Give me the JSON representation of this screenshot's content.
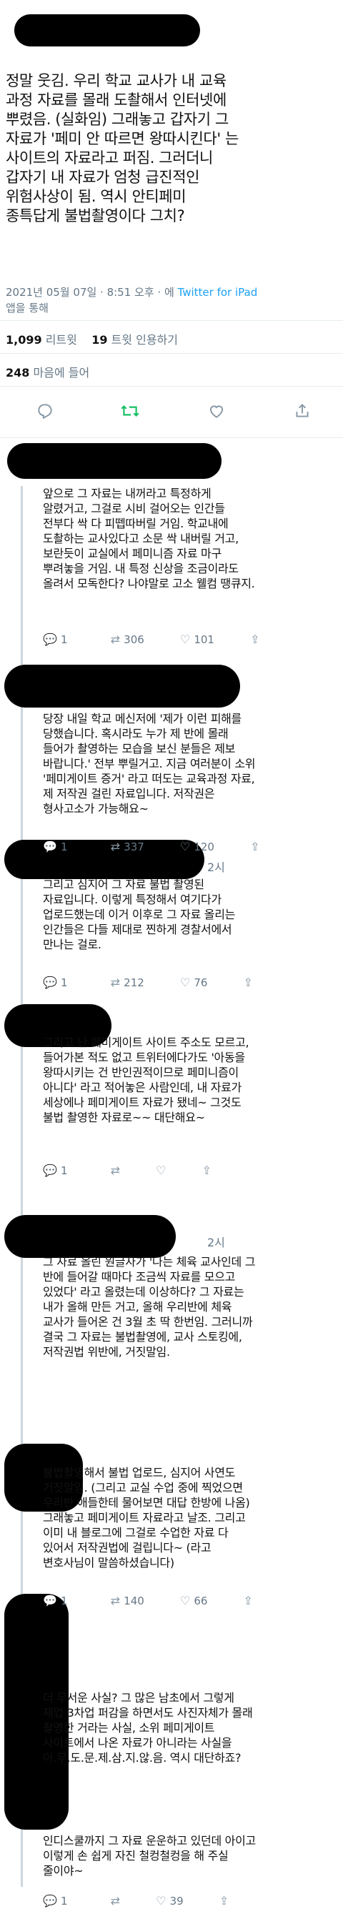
{
  "tweet": {
    "text_lines": [
      "정말 웃김. 우리 학교 교사가 내 교육",
      "과정 자료를 몰래 도촬해서 인터넷에",
      "뿌렸음. (실화임) 그래놓고 갑자기 그",
      "자료가 '페미 안 따르면 왕따시킨다' 는",
      "사이트의 자료라고 퍼짐. 그러더니",
      "갑자기 내 자료가 엄청 급진적인",
      "위험사상이 됨. 역시 안티페미",
      "종특답게 불법촬영이다 그치?"
    ],
    "date": "2021년 05월 07일 · 8:51 오후 · 에",
    "source": "Twitter for iPad",
    "via": "앱을 통해",
    "retweets_count": "1,099",
    "retweets_label": "리트윗",
    "quotes_count": "19",
    "quotes_label": "트윗 인용하기",
    "likes_count": "248",
    "likes_label": "마음에 들어"
  },
  "replies": [
    {
      "name": "",
      "lines": [
        "앞으로 그 자료는 내꺼라고 특정하게",
        "알렸거고, 그걸로 시비 걸어오는 인간들",
        "전부다 싹 다 피뗍따버릴 거임. 학교내에",
        "도촬하는 교사있다고 소문 싹 내버릴 거고,",
        "보란듯이 교실에서 페미니즘 자료 마구",
        "뿌려놓을 거임. 내 특정 신상을 조금이라도",
        "올려서 모독한다? 나야말로 고소 웰컴 땡큐지."
      ],
      "replies": "1",
      "retweets": "306",
      "likes": "101"
    },
    {
      "name": "",
      "lines": [
        "당장 내일 학교 메신저에 '제가 이런 피해를",
        "당했습니다. 혹시라도 누가 제 반에 몰래",
        "들어가 촬영하는 모습을 보신 분들은 제보",
        "바랍니다.' 전부 뿌릴거고. 지금 여러분이 소위",
        "'페미게이트 증거' 라고 떠도는 교육과정 자료,",
        "제 저작권 걸린 자료입니다. 저작권은",
        "형사고소가 가능해요~"
      ],
      "replies": "1",
      "retweets": "337",
      "likes": "120"
    },
    {
      "name": "2시",
      "lines": [
        "그리고 심지어 그 자료 불법 촬영된",
        "자료입니다. 이렇게 특정해서 여기다가",
        "업로드했는데 이거 이후로 그 자료 올리는",
        "인간들은 다들 제대로 찐하게 경찰서에서",
        "만나는 걸로."
      ],
      "replies": "1",
      "retweets": "212",
      "likes": "76"
    },
    {
      "name": "",
      "lines": [
        "그리고 난 페미게이트 사이트 주소도 모르고,",
        "들어가본 적도 없고 트위터에다가도 '아동을",
        "왕따시키는 건 반인권적이므로 페미니즘이",
        "아니다' 라고 적어놓은 사람인데, 내 자료가",
        "세상에나 페미게이트 자료가 됐네~ 그것도",
        "불법 촬영한 자료로~~ 대단해요~"
      ],
      "replies": "1",
      "retweets": "",
      "likes": ""
    },
    {
      "name": "2시",
      "lines": [
        "그 자료 올린 원글자가 '나는 체육 교사인데 그",
        "반에 들어갈 때마다 조금씩 자료를 모으고",
        "있었다' 라고 올렸는데 이상하다? 그 자료는",
        "내가 올해 만든 거고, 올해 우리반에 체육",
        "교사가 들어온 건 3월 초 딱 한번임. 그러니까",
        "결국 그 자료는 불법촬영에, 교사 스토킹에,",
        "저작권법 위반에, 거짓말임."
      ],
      "replies": "",
      "retweets": "",
      "likes": ""
    },
    {
      "name": "",
      "lines": [
        "불법촬영해서 불법 업로드, 심지어 사연도",
        "거짓말임. (그리고 교실 수업 중에 찍었으면",
        "우리반 애들한테 물어보면 대답 한방에 나옴)",
        "그래놓고 페미게이트 자료라고 날조. 그리고",
        "이미 내 블로그에 그걸로 수업한 자료 다",
        "있어서 저작권법에 걸립니다~ (라고",
        "변호사님이 말씀하셨습니다)"
      ],
      "replies": "1",
      "retweets": "140",
      "likes": "66"
    },
    {
      "name": "",
      "lines": [
        "더 무서운 사실? 그 많은 남초에서 그렇게",
        "재업 3차업 퍼감을 하면서도 사진자체가 몰래",
        "촬영한 거라는 사실, 소위 페미게이트",
        "사이트에서 나온 자료가 아니라는 사실을",
        "아.무.도.문.제.삼.지.않.음. 역시 대단하죠?"
      ],
      "replies": "",
      "retweets": "",
      "likes": ""
    },
    {
      "name": "",
      "lines": [
        "인디스쿨까지 그 자료 운운하고 있던데 아이고",
        "이렇게 손 쉽게 자진 철컹철컹을 해 주실",
        "줄이야~"
      ],
      "replies": "1",
      "retweets": "",
      "likes": "39"
    }
  ]
}
